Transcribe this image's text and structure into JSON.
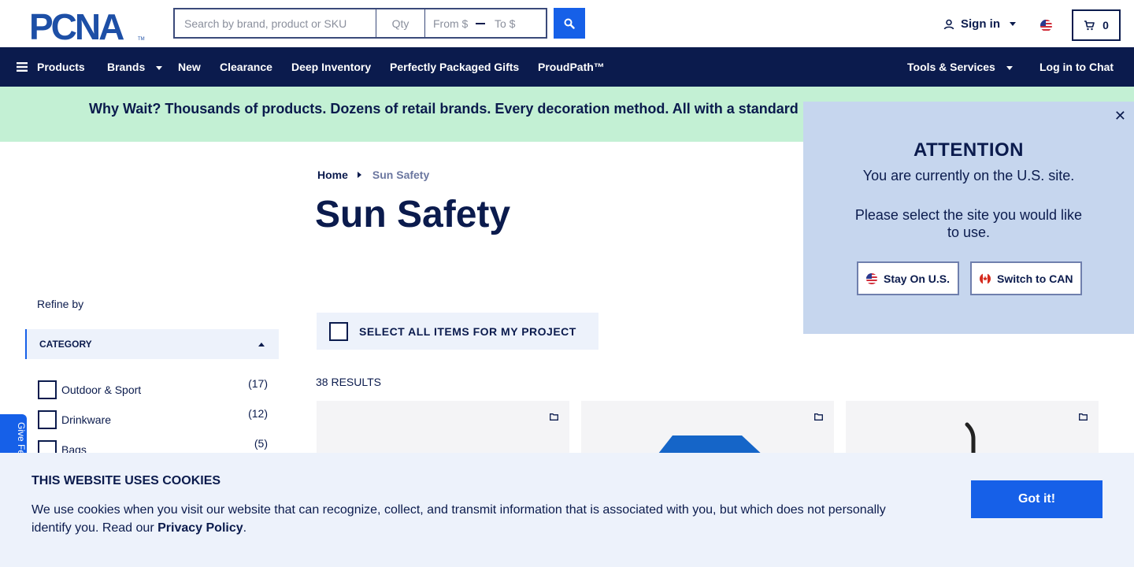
{
  "header": {
    "logo_text": "PCNA",
    "search": {
      "placeholder": "Search by brand, product or SKU",
      "value": ""
    },
    "qty": {
      "placeholder": "Qty"
    },
    "price_from": {
      "placeholder": "From $"
    },
    "price_to": {
      "placeholder": "To $"
    },
    "sign_in_label": "Sign in",
    "cart_count": "0"
  },
  "nav": {
    "products": "Products",
    "brands": "Brands",
    "new": "New",
    "clearance": "Clearance",
    "deep_inventory": "Deep Inventory",
    "gifts": "Perfectly Packaged Gifts",
    "proudpath": "ProudPath™",
    "tools": "Tools & Services",
    "chat": "Log in to Chat"
  },
  "promo": {
    "text": "Why Wait? Thousands of products. Dozens of retail brands. Every decoration method. All with a standard"
  },
  "breadcrumb": {
    "home": "Home",
    "current": "Sun Safety"
  },
  "page_title": "Sun Safety",
  "sidebar": {
    "refine_label": "Refine by",
    "category_header": "CATEGORY",
    "categories": [
      {
        "label": "Outdoor & Sport",
        "count": "(17)"
      },
      {
        "label": "Drinkware",
        "count": "(12)"
      },
      {
        "label": "Bags",
        "count": "(5)"
      }
    ],
    "feedback_label": "Give Fe"
  },
  "main": {
    "select_all_label": "SELECT ALL ITEMS FOR MY PROJECT",
    "results_label": "38 RESULTS"
  },
  "attention": {
    "title": "ATTENTION",
    "line1": "You are currently on the U.S. site.",
    "line2": "Please select the site you would like to use.",
    "stay_label": "Stay On U.S.",
    "switch_label": "Switch to CAN"
  },
  "cookie": {
    "title": "THIS WEBSITE USES COOKIES",
    "text": "We use cookies when you visit our website that can recognize, collect, and transmit information that is associated with you, but which does not personally identify you. Read our",
    "link": "Privacy Policy",
    "period": ".",
    "button": "Got it!"
  },
  "colors": {
    "navy": "#0b1b4d",
    "accent_blue": "#1660e8",
    "promo_green": "#c3f0d4",
    "modal_bg": "#c6d6ee",
    "cookie_bg": "#edf2fb"
  }
}
